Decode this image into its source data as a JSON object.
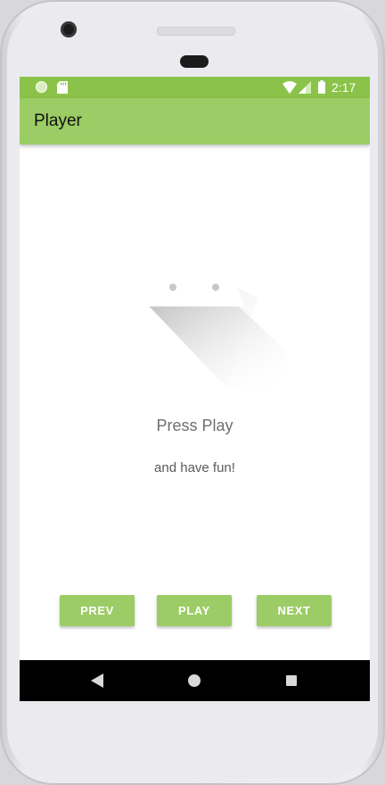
{
  "status_bar": {
    "time": "2:17",
    "icons": [
      "notification-dot-icon",
      "sd-card-icon",
      "wifi-icon",
      "cell-signal-icon",
      "battery-icon"
    ]
  },
  "app_bar": {
    "title": "Player"
  },
  "content": {
    "illustration": "empty-state-media-icon",
    "headline": "Press Play",
    "subline": "and have fun!"
  },
  "controls": {
    "prev_label": "PREV",
    "play_label": "PLAY",
    "next_label": "NEXT"
  },
  "nav_bar": {
    "icons": [
      "back-icon",
      "home-icon",
      "recents-icon"
    ]
  },
  "colors": {
    "status_bar": "#8bc34a",
    "app_bar": "#9ccc65",
    "button": "#9ccc65",
    "nav_bar": "#000000"
  }
}
